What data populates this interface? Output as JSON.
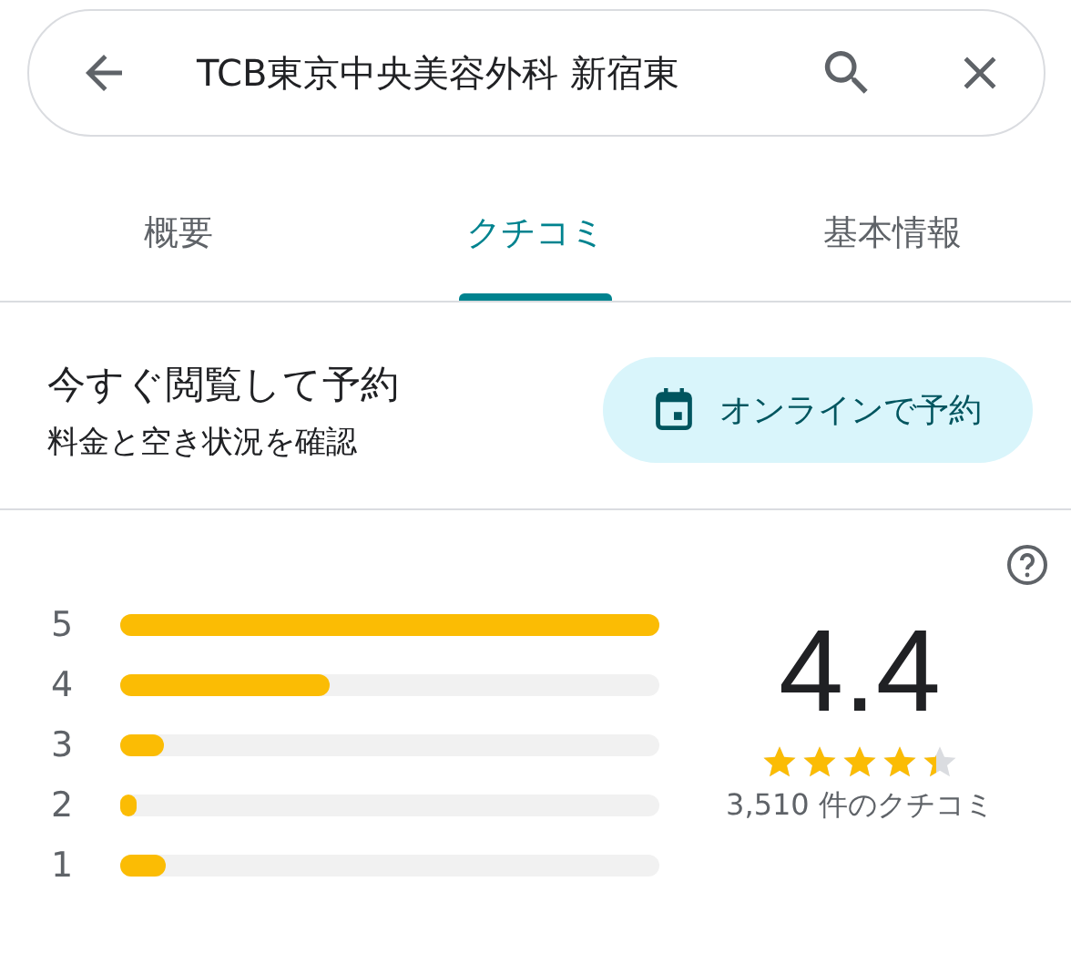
{
  "search": {
    "value": "TCB東京中央美容外科 新宿東"
  },
  "tabs": [
    {
      "label": "概要",
      "selected": false
    },
    {
      "label": "クチコミ",
      "selected": true
    },
    {
      "label": "基本情報",
      "selected": false
    }
  ],
  "booking": {
    "title": "今すぐ閲覧して予約",
    "subtitle": "料金と空き状況を確認",
    "button": "オンラインで予約"
  },
  "histogram": [
    {
      "label": "5",
      "level": 1.0
    },
    {
      "label": "4",
      "level": 0.39
    },
    {
      "label": "3",
      "level": 0.08
    },
    {
      "label": "2",
      "level": 0.03
    },
    {
      "label": "1",
      "level": 0.085
    }
  ],
  "rating": {
    "value": "4.4",
    "stars": 4.4,
    "count": "3,510 件のクチコミ"
  }
}
